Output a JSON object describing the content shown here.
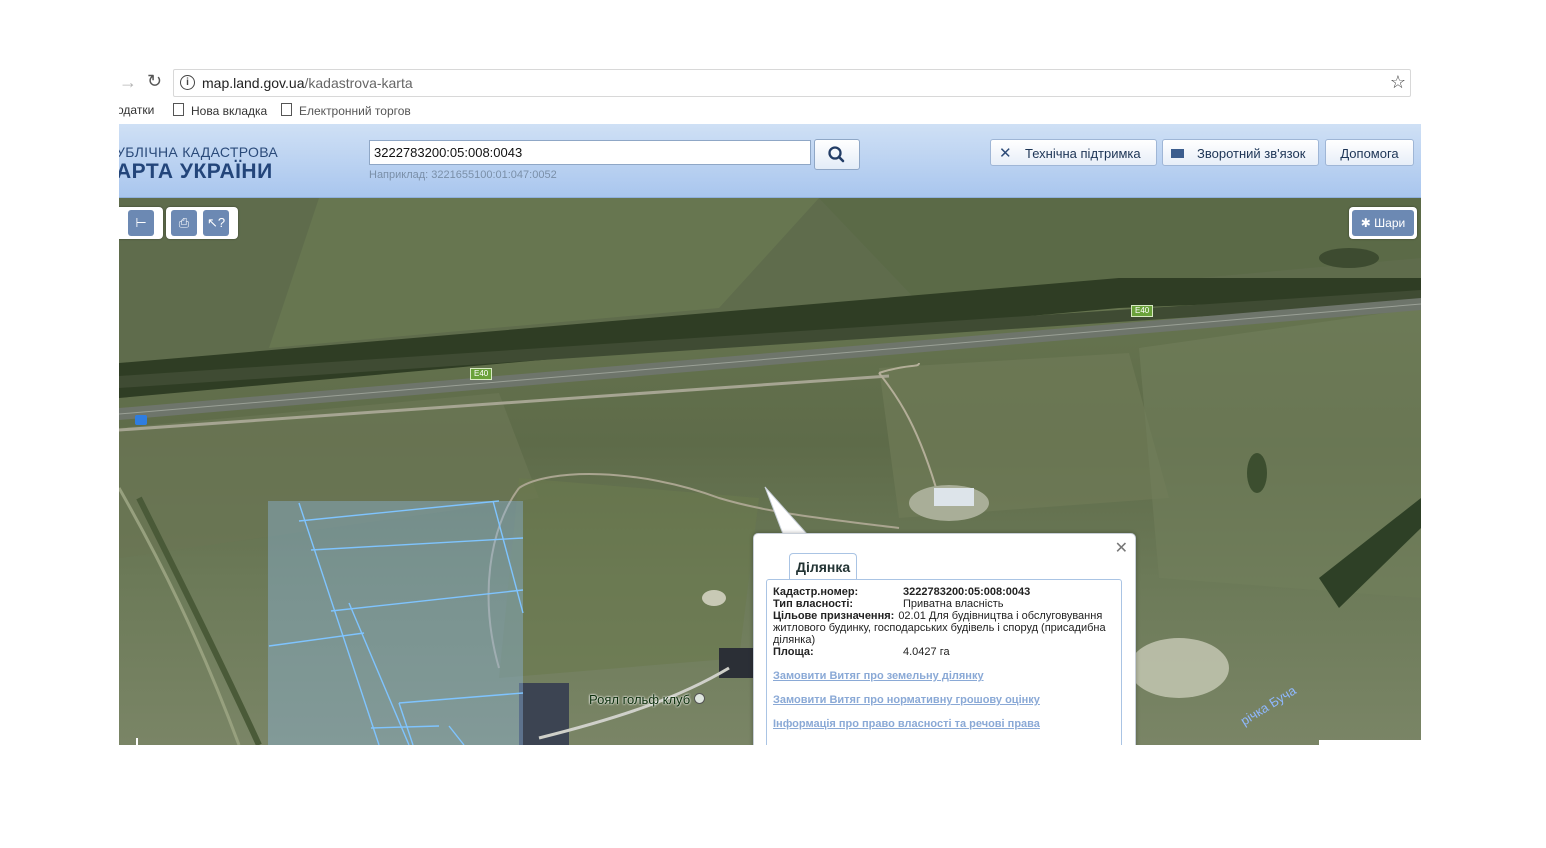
{
  "browser": {
    "url_host": "map.land.gov.ua",
    "url_path": "/kadastrova-karta",
    "bookmarks": [
      "одатки",
      "Нова вкладка",
      "Електронний торгов"
    ]
  },
  "header": {
    "logo_line1": "УБЛІЧНА КАДАСТРОВА",
    "logo_line2": "АРТА УКРАЇНИ",
    "search_value": "3222783200:05:008:0043",
    "search_hint": "Наприклад: 3221655100:01:047:0052",
    "support_label": "Технічна підтримка",
    "feedback_label": "Зворотний зв'язок",
    "help_label": "Допомога"
  },
  "map": {
    "layers_label": "Шари",
    "road_label": "E40",
    "golf_label": "Роял гольф клуб",
    "river_label": "річка Буча"
  },
  "popup": {
    "tab_label": "Ділянка",
    "fields": [
      {
        "label": "Кадастр.номер:",
        "value": "3222783200:05:008:0043"
      },
      {
        "label": "Тип власності:",
        "value": "Приватна власність"
      },
      {
        "label": "Цільове призначення:",
        "value": "02.01 Для будівництва і обслуговування житлового будинку, господарських будівель і споруд (присадибна ділянка)"
      },
      {
        "label": "Площа:",
        "value": "4.0427 га"
      }
    ],
    "links": [
      "Замовити Витяг про земельну ділянку",
      "Замовити Витяг про нормативну грошову оцінку",
      "Інформація про право власності та речові права"
    ]
  }
}
